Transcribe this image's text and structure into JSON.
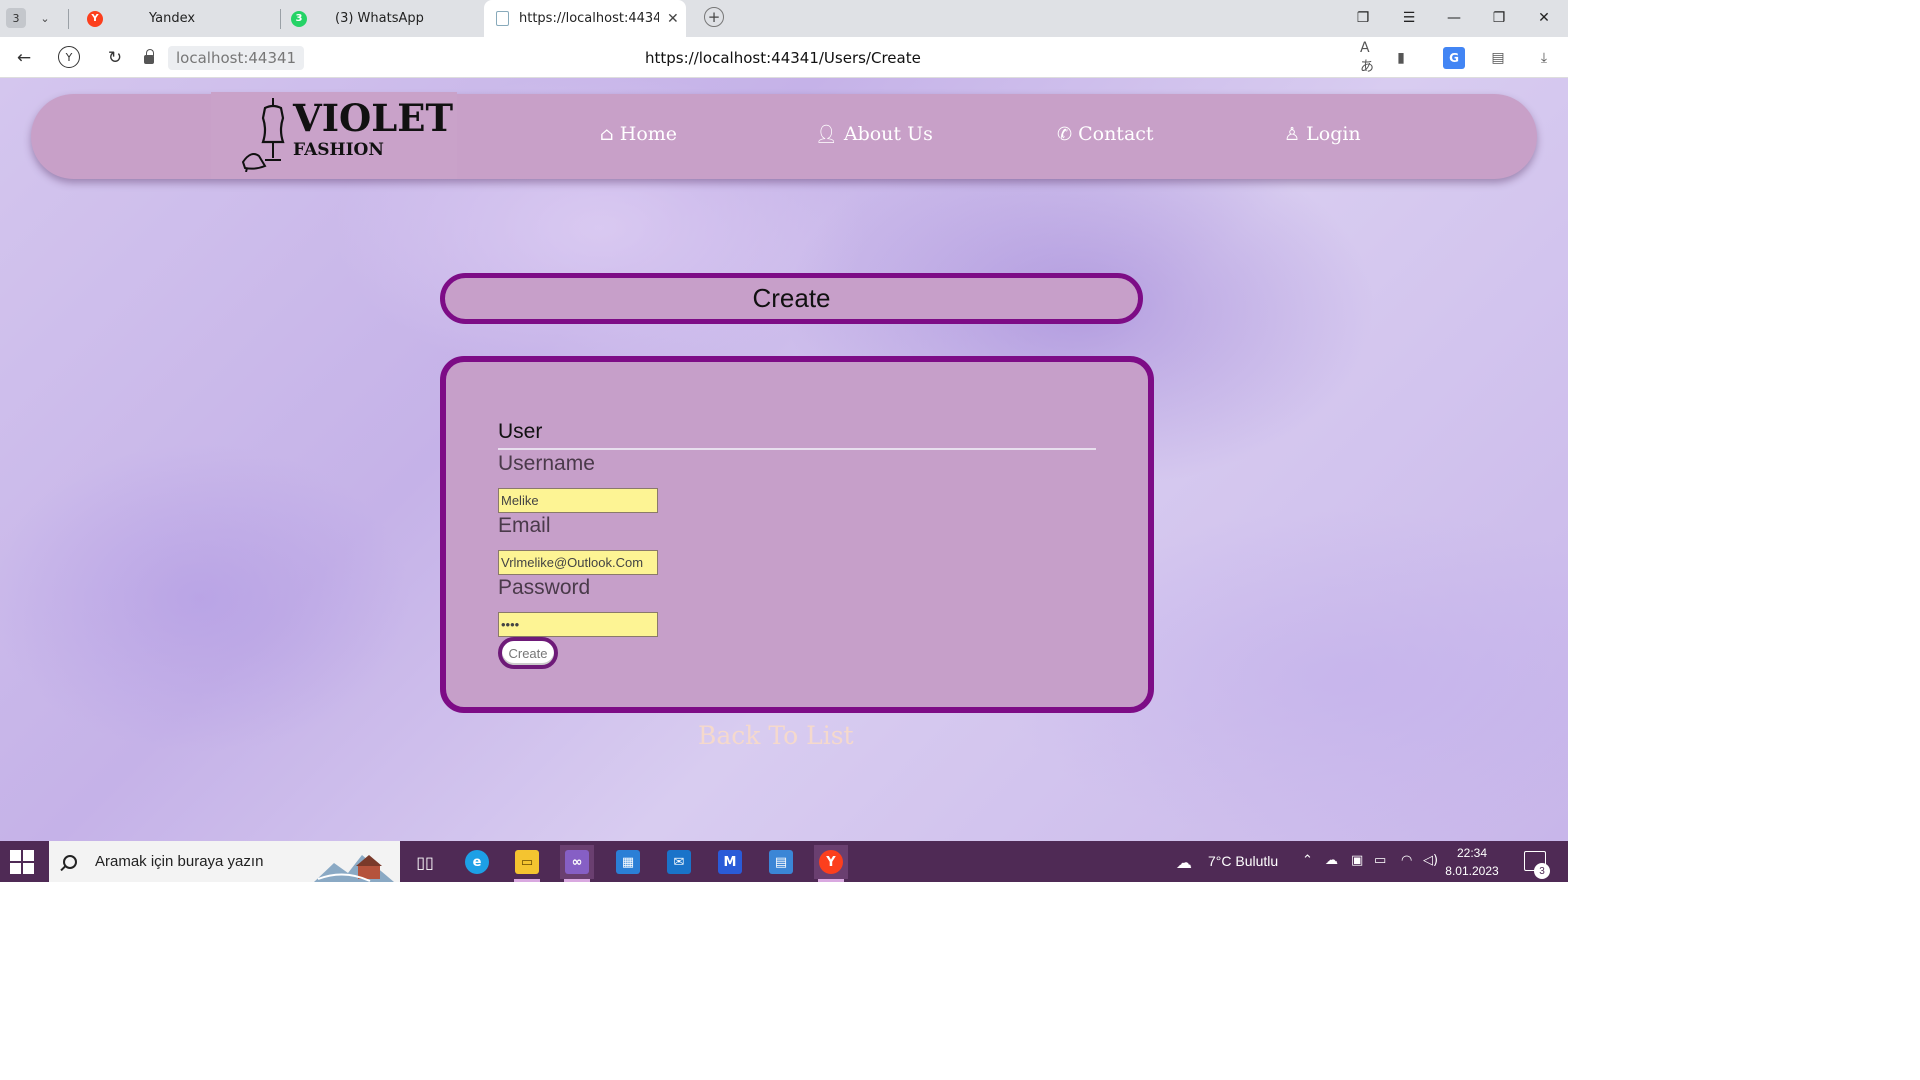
{
  "browser": {
    "tab_count": "3",
    "tabs": [
      {
        "title": "Yandex",
        "icon": "yandex-icon"
      },
      {
        "title": "(3) WhatsApp",
        "icon": "whatsapp-icon",
        "badge": "3"
      },
      {
        "title": "https://localhost:44341/",
        "icon": "page-icon",
        "active": true
      }
    ],
    "host_chip": "localhost:44341",
    "url": "https://localhost:44341/Users/Create"
  },
  "site": {
    "logo": {
      "line1": "VIOLET",
      "line2": "FASHION"
    },
    "nav": [
      {
        "label": "Home",
        "icon": "home-icon"
      },
      {
        "label": "About Us",
        "icon": "user-icon"
      },
      {
        "label": "Contact",
        "icon": "phone-icon"
      },
      {
        "label": "Login",
        "icon": "user-outline-icon"
      }
    ]
  },
  "page": {
    "title": "Create",
    "form": {
      "legend": "User",
      "fields": [
        {
          "label": "Username",
          "value": "Melike"
        },
        {
          "label": "Email",
          "value": "Vrlmelike@Outlook.Com"
        },
        {
          "label": "Password",
          "value": "••••"
        }
      ],
      "submit_label": "Create"
    },
    "back_link": "Back To List"
  },
  "taskbar": {
    "search_placeholder": "Aramak için buraya yazın",
    "weather": "7°C  Bulutlu",
    "time": "22:34",
    "date": "8.01.2023",
    "notifications": "3"
  },
  "colors": {
    "nav_bg": "#c8a0c8",
    "card_border": "#7d0c86",
    "card_bg": "#c69fc9",
    "input_bg": "#fdf494",
    "back_link": "#f5d9cc",
    "taskbar": "#4f2a55"
  }
}
